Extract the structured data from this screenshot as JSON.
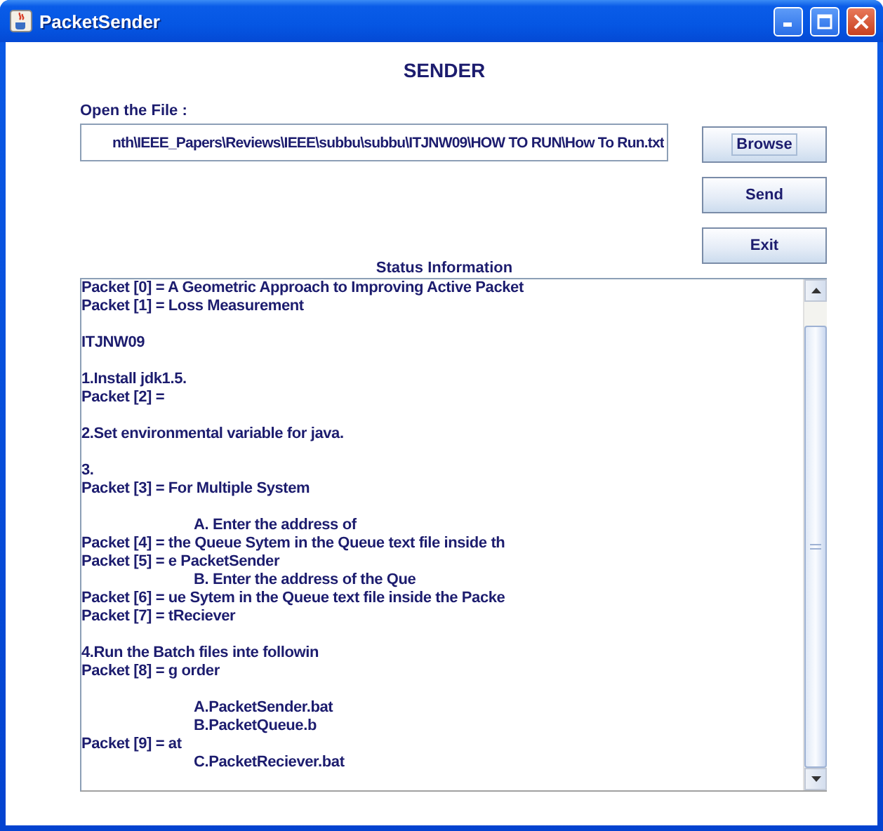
{
  "window": {
    "title": "PacketSender"
  },
  "heading": "SENDER",
  "file": {
    "label": "Open the File :",
    "value": "nth\\IEEE_Papers\\Reviews\\IEEE\\subbu\\subbu\\ITJNW09\\HOW TO RUN\\How To Run.txt"
  },
  "buttons": [
    {
      "label": "Browse",
      "focused": true
    },
    {
      "label": "Send",
      "focused": false
    },
    {
      "label": "Exit",
      "focused": false
    }
  ],
  "status": {
    "title": "Status Information",
    "lines": [
      {
        "kind": "line",
        "text": "Packet [0] = A Geometric Approach to Improving Active Packet"
      },
      {
        "kind": "line",
        "text": "Packet [1] = Loss Measurement"
      },
      {
        "kind": "gap"
      },
      {
        "kind": "line",
        "text": "ITJNW09"
      },
      {
        "kind": "gap"
      },
      {
        "kind": "line",
        "text": "1.Install jdk1.5."
      },
      {
        "kind": "line",
        "text": "Packet [2] ="
      },
      {
        "kind": "gap"
      },
      {
        "kind": "line",
        "text": "2.Set environmental variable for java."
      },
      {
        "kind": "gap"
      },
      {
        "kind": "line",
        "text": "3."
      },
      {
        "kind": "line",
        "text": "Packet [3] = For Multiple System"
      },
      {
        "kind": "gap"
      },
      {
        "kind": "indented",
        "text": "A. Enter the address of"
      },
      {
        "kind": "line",
        "text": "Packet [4] = the Queue Sytem in the Queue text file inside th"
      },
      {
        "kind": "line",
        "text": "Packet [5] = e PacketSender"
      },
      {
        "kind": "indented",
        "text": "B. Enter the address of the Que"
      },
      {
        "kind": "line",
        "text": "Packet [6] = ue Sytem in the Queue text file inside the Packe"
      },
      {
        "kind": "line",
        "text": "Packet [7] = tReciever"
      },
      {
        "kind": "gap"
      },
      {
        "kind": "line",
        "text": "4.Run the Batch files inte followin"
      },
      {
        "kind": "line",
        "text": "Packet [8] = g order"
      },
      {
        "kind": "gap"
      },
      {
        "kind": "indented",
        "text": "A.PacketSender.bat"
      },
      {
        "kind": "indented",
        "text": "B.PacketQueue.b"
      },
      {
        "kind": "line",
        "text": "Packet [9] = at"
      },
      {
        "kind": "indented",
        "text": "C.PacketReciever.bat"
      }
    ]
  }
}
